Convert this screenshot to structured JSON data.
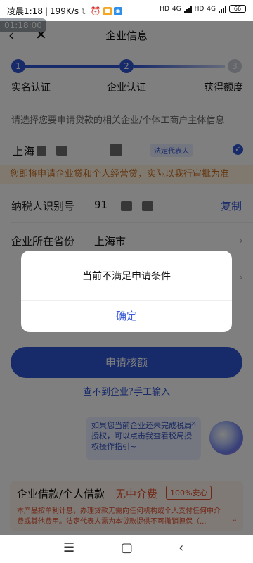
{
  "status_bar": {
    "time": "凌晨1:18",
    "speed": "199K/s",
    "network_labels": [
      "HD",
      "4G",
      "HD",
      "4G"
    ],
    "battery": "66",
    "timer": "01:18:00"
  },
  "navbar": {
    "title": "企业信息"
  },
  "steps": [
    {
      "number": "1",
      "label": "实名认证",
      "state": "done"
    },
    {
      "number": "2",
      "label": "企业认证",
      "state": "current"
    },
    {
      "number": "3",
      "label": "获得额度",
      "state": "pending"
    }
  ],
  "hint": "请选择您要申请贷款的相关企业/个体工商户主体信息",
  "company": {
    "name_visible": "上海",
    "tag": "法定代表人"
  },
  "notice": "您即将申请企业贷和个人经营贷，实际以我行审批为准",
  "fields": {
    "taxpayer_label": "纳税人识别号",
    "taxpayer_value": "91",
    "taxpayer_action": "复制",
    "province_label": "企业所在省份",
    "province_value": "上海市"
  },
  "apply_button": "申请核额",
  "manual_link": "查不到企业?手工输入",
  "tip": {
    "text": "如果您当前企业还未完成税局授权，可以点击我查看税局授权操作指引~",
    "close": "×"
  },
  "promo": {
    "title": "企业借款/个人借款",
    "free": "无中介费",
    "badge": "100%安心",
    "desc": "本产品按单利计息，办理贷款无需向任何机构或个人支付任何中介费或其他费用。法定代表人需为本贷款提供不可撤销担保（..."
  },
  "dialog": {
    "message": "当前不满足申请条件",
    "ok": "确定"
  },
  "colors": {
    "primary": "#2f55d4",
    "accent_orange": "#e24c2d",
    "notice_bg": "#fff3e0"
  },
  "icons": {
    "back": "chevron-left",
    "close": "x",
    "check": "check-circle",
    "menu": "three-lines",
    "home": "square",
    "recent_back": "triangle-left"
  }
}
